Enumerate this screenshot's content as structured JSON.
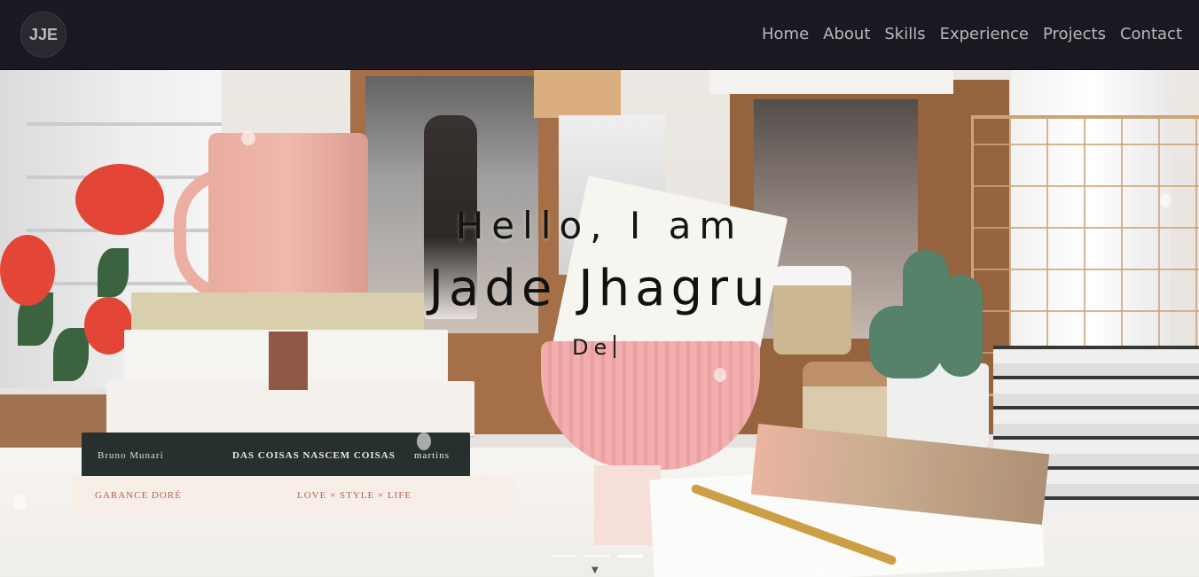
{
  "logo": {
    "text": "JJE"
  },
  "nav": {
    "links": [
      "Home",
      "About",
      "Skills",
      "Experience",
      "Projects",
      "Contact"
    ]
  },
  "hero": {
    "greeting": "Hello, I am",
    "name": "Jade Jhagru",
    "typed_text": "De"
  },
  "books": {
    "author": "Bruno Munari",
    "title1": "DAS COISAS NASCEM COISAS",
    "publisher": "martins",
    "author2": "GARANCE DORÉ",
    "title2": "LOVE × STYLE × LIFE"
  },
  "carousel": {
    "slide_count": 3,
    "active_index": 2
  },
  "colors": {
    "navbar_bg": "#12101a",
    "nav_text": "#b8b8b8",
    "hero_text": "#141414"
  }
}
